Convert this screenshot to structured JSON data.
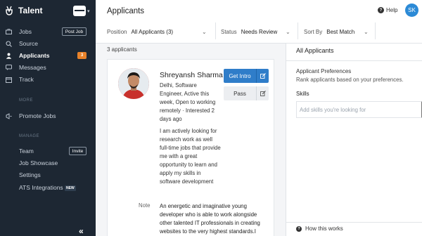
{
  "app": {
    "name": "Talent"
  },
  "sidebar": {
    "items": [
      {
        "label": "Jobs",
        "icon": "briefcase-icon"
      },
      {
        "label": "Source",
        "icon": "search-icon"
      },
      {
        "label": "Applicants",
        "icon": "user-icon",
        "badge": "3"
      },
      {
        "label": "Messages",
        "icon": "chat-icon"
      },
      {
        "label": "Track",
        "icon": "calendar-icon"
      }
    ],
    "post_job": "Post Job",
    "section_more": "MORE",
    "promote": {
      "label": "Promote Jobs",
      "icon": "megaphone-icon"
    },
    "section_manage": "MANAGE",
    "manage": [
      {
        "label": "Team"
      },
      {
        "label": "Job Showcase"
      },
      {
        "label": "Settings"
      },
      {
        "label": "ATS Integrations"
      }
    ],
    "invite": "Invite",
    "new_badge": "NEW",
    "collapse": "«"
  },
  "header": {
    "title": "Applicants",
    "help": "Help",
    "avatar_initials": "SK",
    "filters": {
      "position": {
        "label": "Position",
        "value": "All Applicants (3)"
      },
      "status": {
        "label": "Status",
        "value": "Needs Review"
      },
      "sort": {
        "label": "Sort By",
        "value": "Best Match"
      }
    }
  },
  "main": {
    "count": "3 applicants",
    "candidate": {
      "name": "Shreyansh Sharma",
      "details": "Delhi, Software Engineer, Active this week, Open to working remotely · Interested 2 days ago",
      "summary": "I am actively looking for research work as well full-time jobs that provide me with a great opportunity to learn and apply my skills in software development",
      "note_label": "Note",
      "note": "An energetic and imaginative young developer who is able to work alongside other talented IT professionals in creating websites to the very highest standards.I"
    },
    "buttons": {
      "intro": "Get Intro",
      "pass": "Pass"
    }
  },
  "panel": {
    "title": "All Applicants",
    "pref_title": "Applicant Preferences",
    "pref_sub": "Rank applicants based on your preferences.",
    "skills_label": "Skills",
    "skills_placeholder": "Add skills you're looking for",
    "how_it_works": "How this works"
  },
  "colors": {
    "sidebar_bg": "#1d2733",
    "accent": "#2f7dc9",
    "badge": "#e8822a",
    "avatar": "#2c8ad6"
  }
}
